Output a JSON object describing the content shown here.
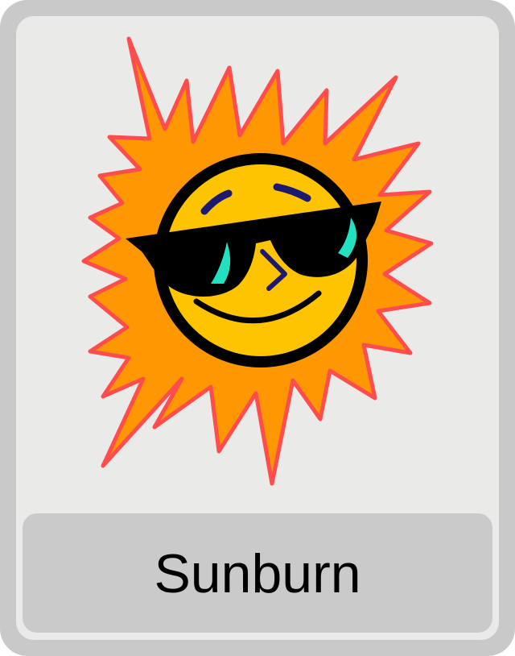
{
  "card": {
    "label": "Sunburn",
    "image_icon": "sun-with-sunglasses-icon"
  },
  "colors": {
    "frame": "#c9c9c9",
    "panel": "#eaeae9",
    "label_bg": "#cacaca",
    "sun_rays": "#ff9800",
    "sun_ray_outline": "#ff4d4d",
    "sun_face": "#ffc400",
    "sunglasses": "#000000",
    "lens_glare": "#22e0c0",
    "features": "#1c1a6e"
  }
}
